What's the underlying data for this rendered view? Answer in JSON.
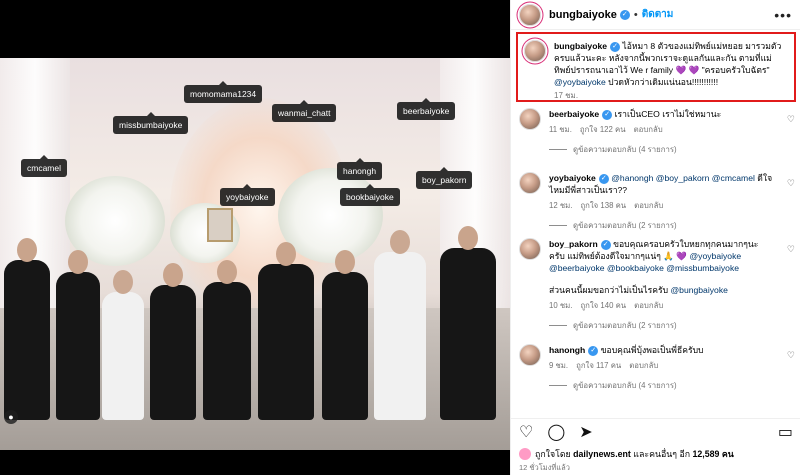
{
  "post": {
    "username": "bungbaiyoke",
    "follow_label": "ติดตาม",
    "more_label": "•••",
    "dot": "•"
  },
  "photo": {
    "tags": [
      {
        "name": "momomama1234"
      },
      {
        "name": "missbumbaiyoke"
      },
      {
        "name": "wanmai_chatt"
      },
      {
        "name": "beerbaiyoke"
      },
      {
        "name": "cmcamel"
      },
      {
        "name": "hanongh"
      },
      {
        "name": "yoybaiyoke"
      },
      {
        "name": "bookbaiyoke"
      },
      {
        "name": "boy_pakorn"
      }
    ],
    "user_icon": "person-icon"
  },
  "caption": {
    "username": "bungbaiyoke",
    "text_part1": "ไอ้หมา 8 ตัวของแม่ทิพย์แม่หยอย มารวมตัวครบแล้วนะคะ หลังจากนี้พวกเราจะดูแลกันและกัน ตามที่แม่ทิพย์ปรารถนาเอาไว้ We r family 💜 💜 \"ครอบครัวใบฉัตร\"",
    "mention": "@yoybaiyoke",
    "text_part2": "ปวดหัวกว่าเดิมแน่นอน!!!!!!!!!!!",
    "time": "17 ชม."
  },
  "comments": [
    {
      "username": "beerbaiyoke",
      "text": "เราเป็นCEO เราไม่ใช่หมานะ",
      "time": "11 ชม.",
      "likes": "ถูกใจ 122 คน",
      "reply_label": "ตอบกลับ",
      "view_replies": "ดูข้อความตอบกลับ (4 รายการ)"
    },
    {
      "username": "yoybaiyoke",
      "mentions": "@hanongh @boy_pakorn @cmcamel",
      "text": "ดีใจไหมมีพี่สาวเป็นเรา??",
      "time": "12 ชม.",
      "likes": "ถูกใจ 138 คน",
      "reply_label": "ตอบกลับ",
      "view_replies": "ดูข้อความตอบกลับ (2 รายการ)"
    },
    {
      "username": "boy_pakorn",
      "text": "ขอบคุณครอบครัวใบหยกทุกคนมากๆนะครับ แม่ทิพย์ต้องดีใจมากๆแน่ๆ 🙏 💜",
      "mentions": "@yoybaiyoke @beerbaiyoke @bookbaiyoke @missbumbaiyoke",
      "text2": "ส่วนคนนี้ผมขอกว่าไม่เป็นไรครับ",
      "mention2": "@bungbaiyoke",
      "time": "10 ชม.",
      "likes": "ถูกใจ 140 คน",
      "reply_label": "ตอบกลับ",
      "view_replies": "ดูข้อความตอบกลับ (2 รายการ)"
    },
    {
      "username": "hanongh",
      "text": "ขอบคุณพี่บุ้งพอเป็นพี่ธีครับบ",
      "time": "9 ชม.",
      "likes": "ถูกใจ 117 คน",
      "reply_label": "ตอบกลับ",
      "view_replies": "ดูข้อความตอบกลับ (4 รายการ)"
    }
  ],
  "actions": {
    "like_icon": "heart-icon",
    "comment_icon": "comment-icon",
    "share_icon": "send-icon",
    "save_icon": "bookmark-icon"
  },
  "likes_line": {
    "prefix": "ถูกใจโดย",
    "user": "dailynews.ent",
    "middle": "และคนอื่นๆ อีก",
    "count": "12,589 คน"
  },
  "time_ago": "12 ชั่วโมงที่แล้ว"
}
